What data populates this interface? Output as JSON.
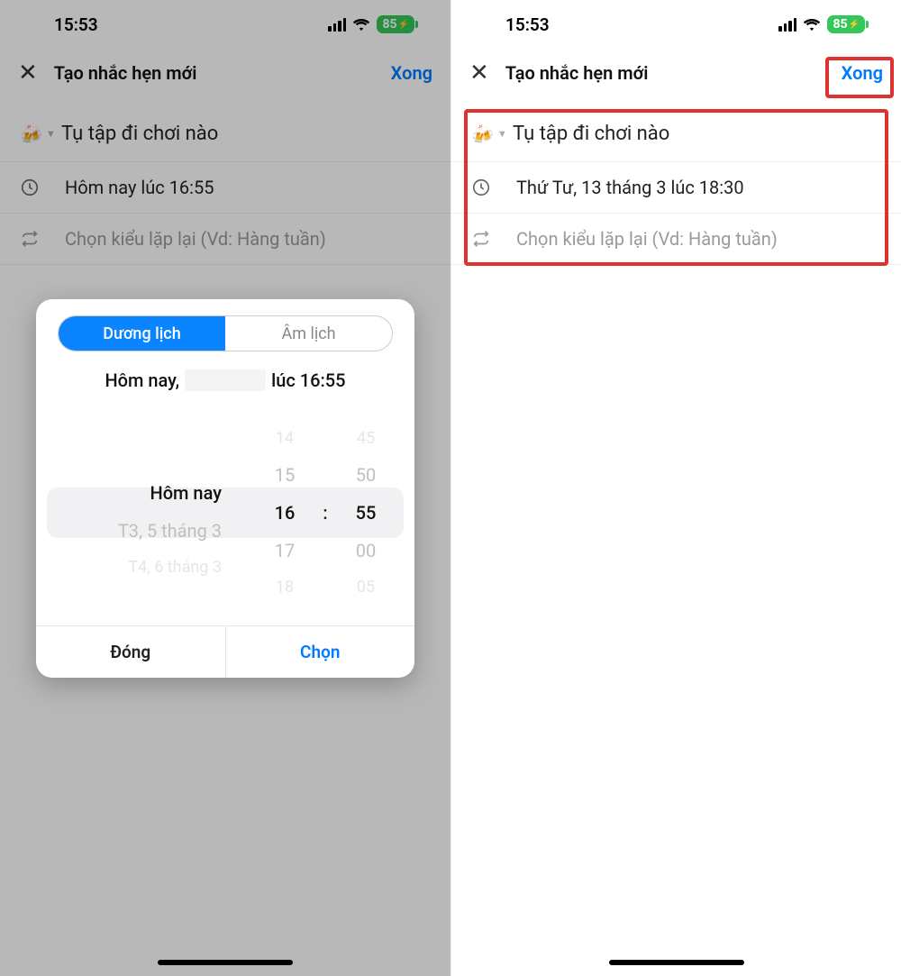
{
  "status": {
    "time": "15:53",
    "battery": "85"
  },
  "header": {
    "title": "Tạo nhắc hẹn mới",
    "done": "Xong"
  },
  "reminder": {
    "emoji": "🍻",
    "title": "Tụ tập đi chơi nào"
  },
  "left": {
    "datetime": "Hôm nay lúc 16:55",
    "repeat_placeholder": "Chọn kiểu lặp lại (Vd: Hàng tuần)"
  },
  "right": {
    "datetime": "Thứ Tư, 13 tháng 3 lúc 18:30",
    "repeat_placeholder": "Chọn kiểu lặp lại (Vd: Hàng tuần)"
  },
  "picker": {
    "seg_solar": "Dương lịch",
    "seg_lunar": "Âm lịch",
    "heading_prefix": "Hôm nay,",
    "heading_suffix": "lúc 16:55",
    "date_col": {
      "prev2": "",
      "prev1": "",
      "sel": "Hôm nay",
      "next1": "T3, 5 tháng 3",
      "next2": "T4, 6 tháng 3"
    },
    "hour_col": {
      "prev2": "14",
      "prev1": "15",
      "sel": "16",
      "next1": "17",
      "next2": "18"
    },
    "min_col": {
      "prev2": "45",
      "prev1": "50",
      "sel": "55",
      "next1": "00",
      "next2": "05"
    },
    "colon": ":",
    "btn_close": "Đóng",
    "btn_select": "Chọn"
  }
}
